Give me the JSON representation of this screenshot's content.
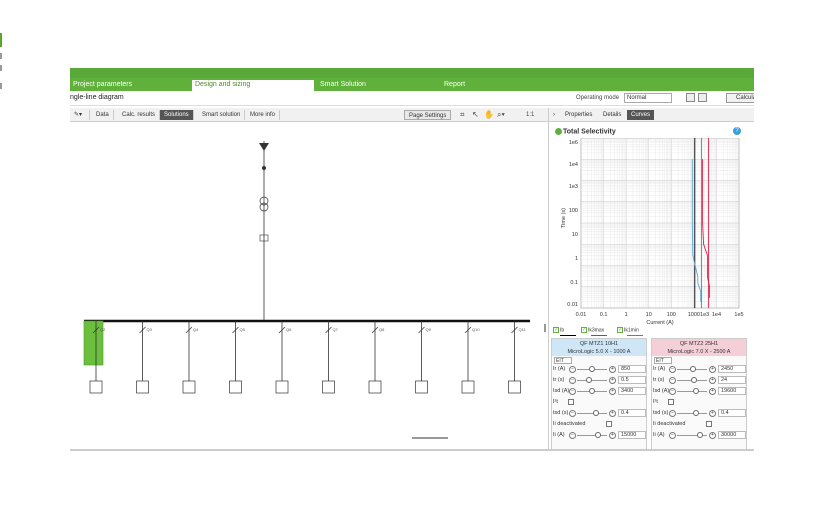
{
  "tabs": [
    "Project parameters",
    "Design and sizing",
    "Smart Solution",
    "Report"
  ],
  "breadcrumb": "ngle-line diagram",
  "operating_mode": {
    "label": "Operating mode",
    "value": "Normal"
  },
  "calculate_label": "Calcula",
  "toolbar": {
    "tabs": [
      "Data",
      "Calc. results",
      "Solutions",
      "Smart solution",
      "More info"
    ],
    "active": "Solutions",
    "page_settings": "Page Settings",
    "zoom_hint": "1:1"
  },
  "right_tabs": [
    "Properties",
    "Details",
    "Curves"
  ],
  "active_right_tab": "Curves",
  "selectivity_title": "Total Selectivity",
  "chart_data": {
    "type": "line",
    "xlabel": "Current (A)",
    "ylabel": "Time (s)",
    "x_scale": "log",
    "y_scale": "log",
    "xlim": [
      0.01,
      100000
    ],
    "ylim": [
      0.01,
      1000000
    ],
    "x_ticks": [
      "0.01",
      "0.1",
      "1",
      "10",
      "100",
      "1000",
      "1e3",
      "1e4",
      "1e5"
    ],
    "y_ticks": [
      "1e6",
      "1e4",
      "1e3",
      "100",
      "10",
      "1",
      "0.1",
      "0.01"
    ],
    "grid": true,
    "series": [
      {
        "name": "QF",
        "color": "#000000",
        "x": [
          1100,
          1100
        ],
        "y": [
          1000000,
          0.01
        ]
      },
      {
        "name": "QF",
        "color": "#2aa84a",
        "x": [
          2200,
          2200
        ],
        "y": [
          1000000,
          0.01
        ]
      },
      {
        "name": "QF",
        "color": "#e0204a",
        "x": [
          4500,
          4500
        ],
        "y": [
          1000000,
          0.01
        ]
      },
      {
        "name": "QF MTZ1",
        "color": "#5aa8e0",
        "x": [
          850,
          850,
          900,
          1500,
          1500,
          2000,
          2000
        ],
        "y": [
          100000,
          100,
          3,
          0.3,
          0.15,
          0.06,
          0.02
        ]
      },
      {
        "name": "QF MTZ2",
        "color": "#e0204a",
        "x": [
          2450,
          2450,
          2700,
          4000,
          4000,
          5000,
          5000
        ],
        "y": [
          100000,
          100,
          10,
          3,
          0.3,
          0.1,
          0.03
        ]
      }
    ]
  },
  "legend": [
    {
      "label": "Ib",
      "color": "#000000"
    },
    {
      "label": "Ik3max",
      "color": "#e0204a"
    },
    {
      "label": "Ik1min",
      "color": "#2aa84a"
    }
  ],
  "devices": [
    {
      "title": "QF MTZ1 10H1",
      "subtitle": "MicroLogic 5.0 X - 1000 A",
      "eit": "EIT",
      "params": [
        {
          "label": "Ir (A)",
          "value": "850",
          "knob": 0.45
        },
        {
          "label": "tr (s)",
          "value": "0.5",
          "knob": 0.35
        },
        {
          "label": "Isd (A)",
          "value": "3400",
          "knob": 0.45
        },
        {
          "label": "I²t",
          "checkbox": true
        },
        {
          "label": "tsd (s)",
          "value": "0.4",
          "knob": 0.6
        },
        {
          "label": "Ii deactivated",
          "checkbox": true
        },
        {
          "label": "Ii (A)",
          "value": "15000",
          "knob": 0.7
        }
      ]
    },
    {
      "title": "QF MTZ2 25H1",
      "subtitle": "MicroLogic 7.0 X - 2500 A",
      "eit": "EIT",
      "params": [
        {
          "label": "Ir (A)",
          "value": "2450",
          "knob": 0.5
        },
        {
          "label": "tr (s)",
          "value": "24",
          "knob": 0.55
        },
        {
          "label": "Isd (A)",
          "value": "19600",
          "knob": 0.6
        },
        {
          "label": "I²t",
          "checkbox": true
        },
        {
          "label": "tsd (s)",
          "value": "0.4",
          "knob": 0.6
        },
        {
          "label": "Ii deactivated",
          "checkbox": true
        },
        {
          "label": "Ii (A)",
          "value": "30000",
          "knob": 0.75
        }
      ]
    }
  ],
  "feeders": [
    "Q2",
    "Q3",
    "Q4",
    "Q5",
    "Q6",
    "Q7",
    "Q8",
    "Q9",
    "Q10",
    "Q11",
    "Q12"
  ]
}
